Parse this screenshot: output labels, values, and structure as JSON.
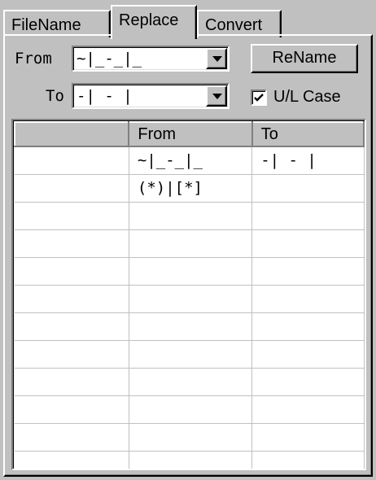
{
  "tabs": [
    {
      "label": "FileName"
    },
    {
      "label": "Replace"
    },
    {
      "label": "Convert"
    }
  ],
  "form": {
    "from_label": "From",
    "from_value": "~|_-_|_",
    "to_label": "To",
    "to_value": "-| - |",
    "rename_label": "ReName",
    "ul_case_label": "U/L Case",
    "ul_case_checked": true
  },
  "grid": {
    "headers": [
      "",
      "From",
      "To"
    ],
    "rows": [
      [
        "",
        "~|_-_|_",
        "-| - |"
      ],
      [
        "",
        "(*)|[*]",
        ""
      ],
      [
        "",
        "",
        ""
      ],
      [
        "",
        "",
        ""
      ],
      [
        "",
        "",
        ""
      ],
      [
        "",
        "",
        ""
      ],
      [
        "",
        "",
        ""
      ],
      [
        "",
        "",
        ""
      ],
      [
        "",
        "",
        ""
      ],
      [
        "",
        "",
        ""
      ],
      [
        "",
        "",
        ""
      ],
      [
        "",
        "",
        ""
      ]
    ]
  }
}
